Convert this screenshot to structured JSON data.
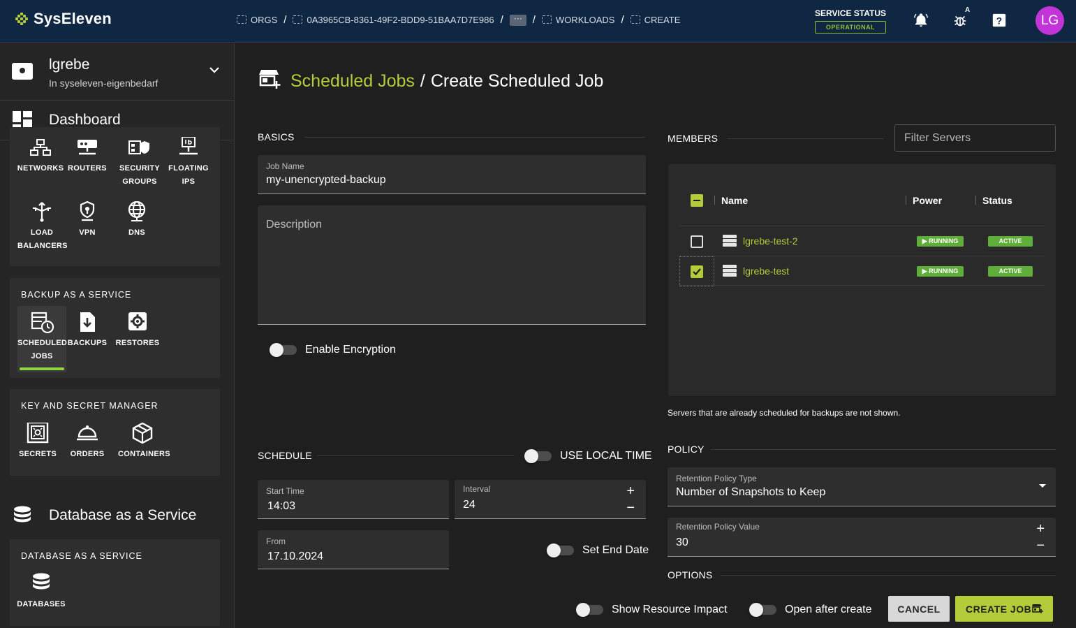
{
  "app": {
    "title": "SysEleven",
    "colors": {
      "accent": "#b5cc3a",
      "topbar": "#0f2742",
      "avatar": "#c234d8",
      "running": "#5fae3a"
    }
  },
  "breadcrumb": [
    {
      "label": "ORGS",
      "icon": "orgs-icon"
    },
    {
      "label": "0A3965CB-8361-49F2-BDD9-51BAA7D7E986",
      "icon": "org-icon"
    },
    {
      "label": "···",
      "icon": "more-icon"
    },
    {
      "label": "WORKLOADS",
      "icon": "workloads-icon"
    },
    {
      "label": "CREATE",
      "icon": "create-icon"
    }
  ],
  "service_status": {
    "title": "SERVICE STATUS",
    "badge": "OPERATIONAL"
  },
  "user": {
    "initials": "LG"
  },
  "header_icons": {
    "notifications": "bell-icon",
    "bug": "bug-icon",
    "help": "help-icon",
    "bug_badge": "A"
  },
  "sidebar": {
    "project_name": "lgrebe",
    "project_sub": "In syseleven-eigenbedarf",
    "dashboard": "Dashboard",
    "network_tiles": [
      {
        "label": "NETWORKS",
        "icon": "networks-icon"
      },
      {
        "label": "ROUTERS",
        "icon": "routers-icon"
      },
      {
        "label": "SECURITY GROUPS",
        "icon": "security-groups-icon"
      },
      {
        "label": "FLOATING IPS",
        "icon": "floating-ips-icon"
      },
      {
        "label": "LOAD BALANCERS",
        "icon": "load-balancers-icon"
      },
      {
        "label": "VPN",
        "icon": "vpn-icon"
      },
      {
        "label": "DNS",
        "icon": "dns-icon"
      }
    ],
    "backup_title": "BACKUP AS A SERVICE",
    "backup_tiles": [
      {
        "label": "SCHEDULED JOBS",
        "icon": "scheduled-jobs-icon",
        "active": true
      },
      {
        "label": "BACKUPS",
        "icon": "backups-icon"
      },
      {
        "label": "RESTORES",
        "icon": "restores-icon"
      }
    ],
    "key_title": "KEY AND SECRET MANAGER",
    "key_tiles": [
      {
        "label": "SECRETS",
        "icon": "secrets-icon"
      },
      {
        "label": "ORDERS",
        "icon": "orders-icon"
      },
      {
        "label": "CONTAINERS",
        "icon": "containers-icon"
      }
    ],
    "db_section": "Database as a Service",
    "db_title": "DATABASE AS A SERVICE",
    "db_tiles": [
      {
        "label": "DATABASES",
        "icon": "databases-icon"
      }
    ]
  },
  "page": {
    "title_link": "Scheduled Jobs",
    "title_sep": "/",
    "title_rest": "Create Scheduled Job"
  },
  "basics": {
    "heading": "BASICS",
    "job_name_label": "Job Name",
    "job_name_value": "my-unencrypted-backup",
    "description_placeholder": "Description",
    "encryption_label": "Enable Encryption"
  },
  "schedule": {
    "heading": "SCHEDULE",
    "local_time_label": "USE LOCAL TIME",
    "start_time_label": "Start Time",
    "start_time_value": "14:03",
    "interval_label": "Interval",
    "interval_value": "24",
    "from_label": "From",
    "from_value": "17.10.2024",
    "end_date_label": "Set End Date"
  },
  "members": {
    "heading": "MEMBERS",
    "filter_placeholder": "Filter Servers",
    "columns": [
      "Name",
      "Power",
      "Status"
    ],
    "rows": [
      {
        "name": "lgrebe-test-2",
        "power": "RUNNING",
        "status": "ACTIVE",
        "checked": false
      },
      {
        "name": "lgrebe-test",
        "power": "RUNNING",
        "status": "ACTIVE",
        "checked": true
      }
    ],
    "note": "Servers that are already scheduled for backups are not shown."
  },
  "policy": {
    "heading": "POLICY",
    "type_label": "Retention Policy Type",
    "type_value": "Number of Snapshots to Keep",
    "value_label": "Retention Policy Value",
    "value_value": "30"
  },
  "options": {
    "heading": "OPTIONS",
    "show_impact_label": "Show Resource Impact",
    "open_after_label": "Open after create",
    "cancel_label": "CANCEL",
    "create_label": "CREATE JOB"
  }
}
